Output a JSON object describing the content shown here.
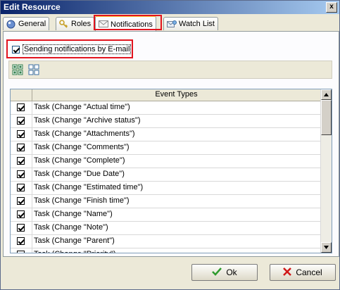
{
  "window": {
    "title": "Edit Resource",
    "close_glyph": "x"
  },
  "tabs": [
    {
      "label": "General",
      "icon": "globe-icon"
    },
    {
      "label": "Roles",
      "icon": "key-icon"
    },
    {
      "label": "Notifications",
      "icon": "envelope-icon",
      "active": true
    },
    {
      "label": "Watch List",
      "icon": "watch-list-icon"
    }
  ],
  "notifications": {
    "send_label": "Sending notifications by E-mail",
    "send_checked": true
  },
  "toolbar": {
    "buttons": [
      "check-all-icon",
      "uncheck-all-icon"
    ]
  },
  "grid": {
    "header": "Event Types",
    "rows": [
      {
        "label": "Task (Change \"Actual time\")",
        "checked": true
      },
      {
        "label": "Task (Change \"Archive status\")",
        "checked": true
      },
      {
        "label": "Task (Change \"Attachments\")",
        "checked": true
      },
      {
        "label": "Task (Change \"Comments\")",
        "checked": true
      },
      {
        "label": "Task (Change \"Complete\")",
        "checked": true
      },
      {
        "label": "Task (Change \"Due Date\")",
        "checked": true
      },
      {
        "label": "Task (Change \"Estimated time\")",
        "checked": true
      },
      {
        "label": "Task (Change \"Finish time\")",
        "checked": true
      },
      {
        "label": "Task (Change \"Name\")",
        "checked": true
      },
      {
        "label": "Task (Change \"Note\")",
        "checked": true
      },
      {
        "label": "Task (Change \"Parent\")",
        "checked": true
      },
      {
        "label": "Task (Change \"Priority\")",
        "checked": true
      }
    ]
  },
  "buttons": {
    "ok": "Ok",
    "cancel": "Cancel"
  },
  "colors": {
    "highlight": "#e2141e",
    "ok_check": "#2e9b2e",
    "cancel_x": "#d01818"
  }
}
